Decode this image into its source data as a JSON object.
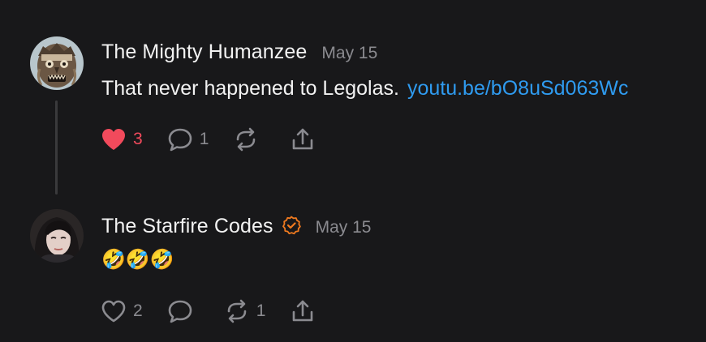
{
  "posts": [
    {
      "author": "The Mighty Humanzee",
      "date": "May 15",
      "text": "That never happened to Legolas.",
      "link": "youtu.be/bO8uSd063Wc",
      "verified": false,
      "likes": "3",
      "liked": true,
      "replies": "1",
      "reposts": "",
      "avatar_icon": "ape-mask-avatar"
    },
    {
      "author": "The Starfire Codes",
      "date": "May 15",
      "text": "🤣🤣🤣",
      "verified": true,
      "likes": "2",
      "liked": false,
      "replies": "",
      "reposts": "1",
      "avatar_icon": "portrait-avatar"
    }
  ],
  "colors": {
    "background": "#18181a",
    "text": "#f2f2f2",
    "muted": "#8b8b90",
    "link": "#2f9bf0",
    "like": "#f24a5c",
    "verified": "#f07a1f",
    "thread_line": "#3a3a3c"
  }
}
